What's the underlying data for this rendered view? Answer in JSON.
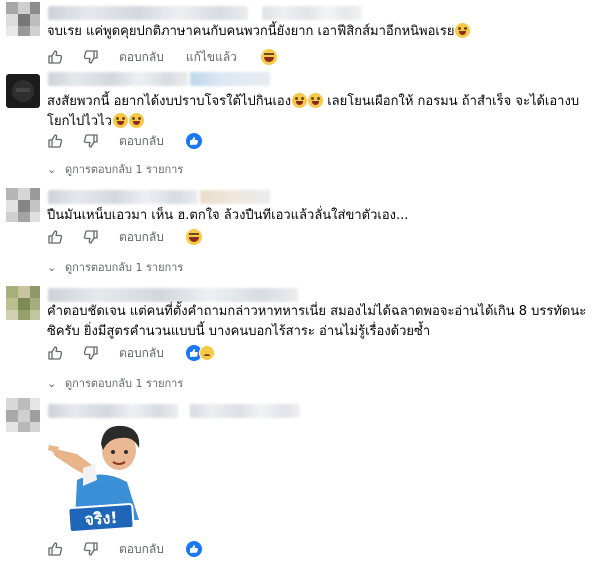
{
  "comments": [
    {
      "text_lines": [
        "จบเรย แค่พูดคุยปกติภาษาคนกับคนพวกนี้ยังยาก เอาฟีสิกส์มาอีกหนิพอเรย"
      ],
      "actions": {
        "reply": "ตอบกลับ",
        "edit": "แก้ไขแล้ว"
      },
      "reaction": "haha"
    },
    {
      "text_lines": [
        "สงสัยพวกนี้ อยากได้งบปราบโจรใต้ไปกินเอง",
        "โยกไปไวไว"
      ],
      "text_line1_suffix": "เลยโยนเผือกให้ กอรมน ถ้าสำเร็จ จะได้เอางบ",
      "actions": {
        "reply": "ตอบกลับ"
      },
      "reaction": "like",
      "replies_link": "ดูการตอบกลับ 1 รายการ"
    },
    {
      "text_lines": [
        "ปืนมันเหน็บเอวมา เห็น ฮ.ตกใจ ล้วงปืนทีเอวแล้วลั่นใส่ขาตัวเอง..."
      ],
      "actions": {
        "reply": "ตอบกลับ"
      },
      "reaction": "haha",
      "replies_link": "ดูการตอบกลับ 1 รายการ"
    },
    {
      "text_lines": [
        "คำตอบชัดเจน แต่คนที่ตั้งคำถามกล่าวหาทหารเนี่ย สมองไม่ได้ฉลาดพอจะอ่านได้เกิน 8 บรรทัดนะ",
        "ซิครับ ยิ่งมีสูตรคำนวนแบบนี้ บางคนบอกไร้สาระ อ่านไม่รู้เรื่องด้วยซ้ำ"
      ],
      "actions": {
        "reply": "ตอบกลับ"
      },
      "reaction": "like-sad",
      "replies_link": "ดูการตอบกลับ 1 รายการ"
    },
    {
      "sticker_text": "จริง!",
      "actions": {
        "reply": "ตอบกลับ"
      },
      "reaction": "like"
    }
  ],
  "colors": {
    "text": "#050505",
    "muted": "#65676b",
    "like_blue": "#1877f2",
    "emoji_yellow": "#f7c948"
  }
}
